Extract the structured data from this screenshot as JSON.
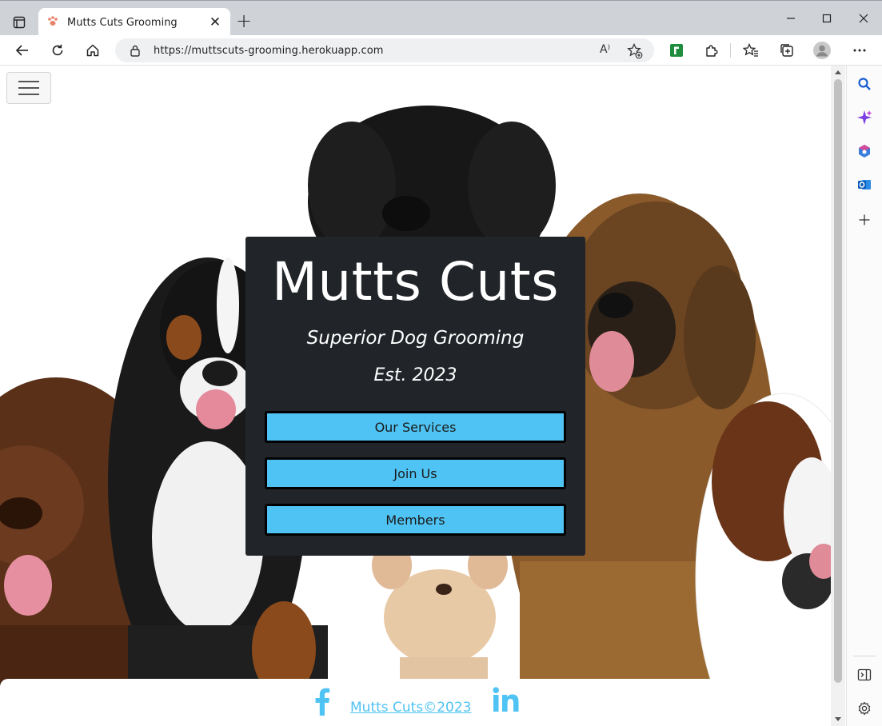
{
  "browser": {
    "tab_title": "Mutts Cuts Grooming",
    "tab_close": "✕",
    "new_tab": "+",
    "url": "https://muttscuts-grooming.herokuapp.com",
    "read_aloud_label": "A⁾"
  },
  "page": {
    "hero": {
      "title": "Mutts Cuts",
      "tagline": "Superior Dog Grooming",
      "established": "Est. 2023",
      "buttons": [
        "Our Services",
        "Join Us",
        "Members"
      ]
    },
    "footer": {
      "link_text": "Mutts Cuts©2023",
      "social": [
        "facebook-icon",
        "linkedin-icon"
      ]
    }
  },
  "colors": {
    "card_bg": "#212529",
    "button_bg": "#4fc3f3",
    "link": "#4fc3f3"
  }
}
